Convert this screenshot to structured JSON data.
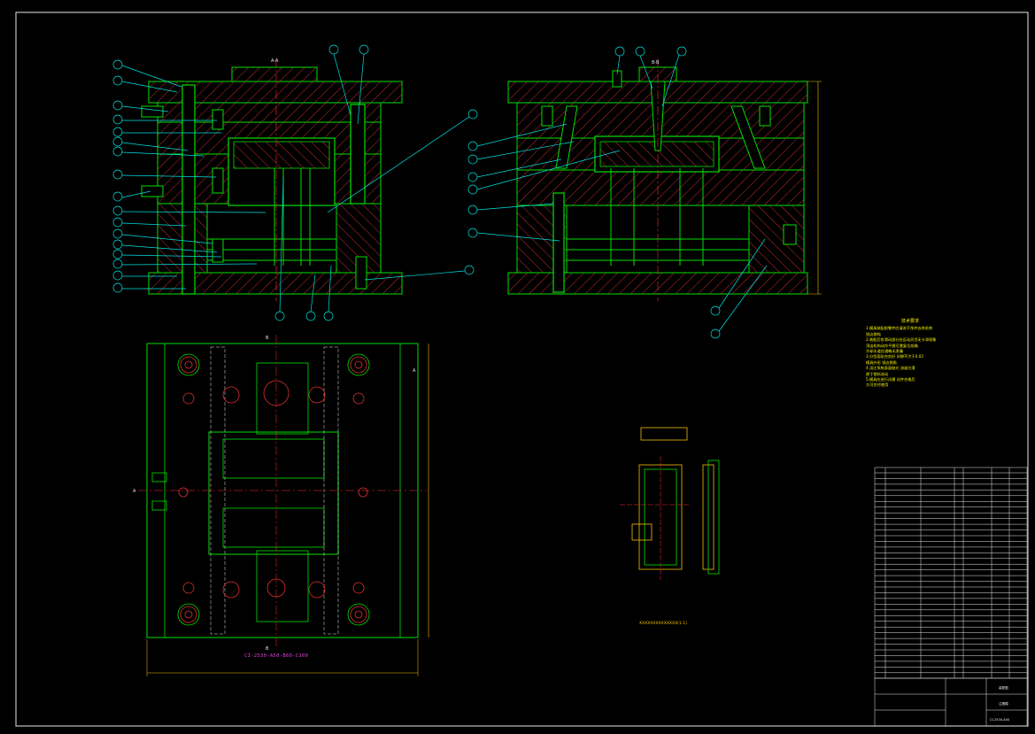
{
  "view_labels": {
    "section_a": "A-A",
    "section_b": "B-B",
    "cut_a": "A",
    "cut_b": "B"
  },
  "plan_caption": "CI-2530-A50-B60-C100",
  "part_caption": "XXXXXXXXXXXXXX(1:1)",
  "notes": {
    "title": "技术要求",
    "lines": [
      "1.模具装配前零件应清洗干净并去除毛刺",
      "  锐边倒钝",
      "2.装配后各滑动部分应运动灵活无卡滞现象",
      "  顶出机构动作平稳可靠复位准确",
      "  冷却水道应通畅无渗漏",
      "3.分型面贴合良好 间隙不大于0.02",
      "  模具外形 锐边倒角",
      "4.浇注系统表面抛光 流道光滑",
      "  便于塑料流动",
      "5.模具应进行试模 试件合格后",
      "  方可交付使用"
    ]
  },
  "title_block": {
    "drawing_title": "装配图",
    "drawing_name": "注塑模",
    "drawing_number": "CI-2530-A50"
  },
  "colors": {
    "plate": "#00e000",
    "hatch": "#e03030",
    "balloon": "#00e0e0",
    "dim": "#e8e8e8",
    "center": "#ff3030",
    "note": "#f4f400",
    "caption": "#e040e0",
    "yellow": "#f4c000"
  }
}
